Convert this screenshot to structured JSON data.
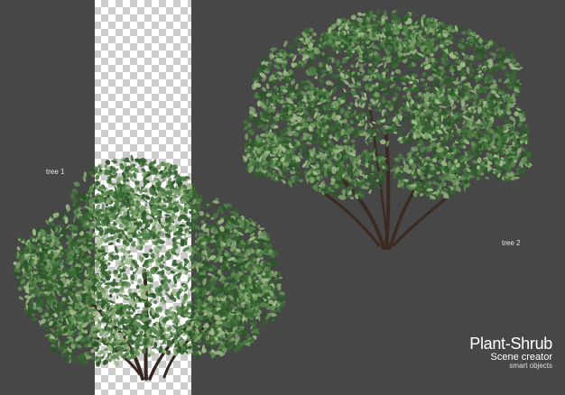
{
  "labels": {
    "tree1": "tree 1",
    "tree2": "tree 2"
  },
  "branding": {
    "title": "Plant-Shrub",
    "subtitle": "Scene creator",
    "tagline": "smart objects"
  },
  "colors": {
    "background": "#474747",
    "foliage_dark": "#2f5a2c",
    "foliage_mid": "#4f7c45",
    "foliage_light": "#8fae7a",
    "trunk": "#3d2a22",
    "checker_light": "#ffffff",
    "checker_dark": "#cccccc"
  }
}
